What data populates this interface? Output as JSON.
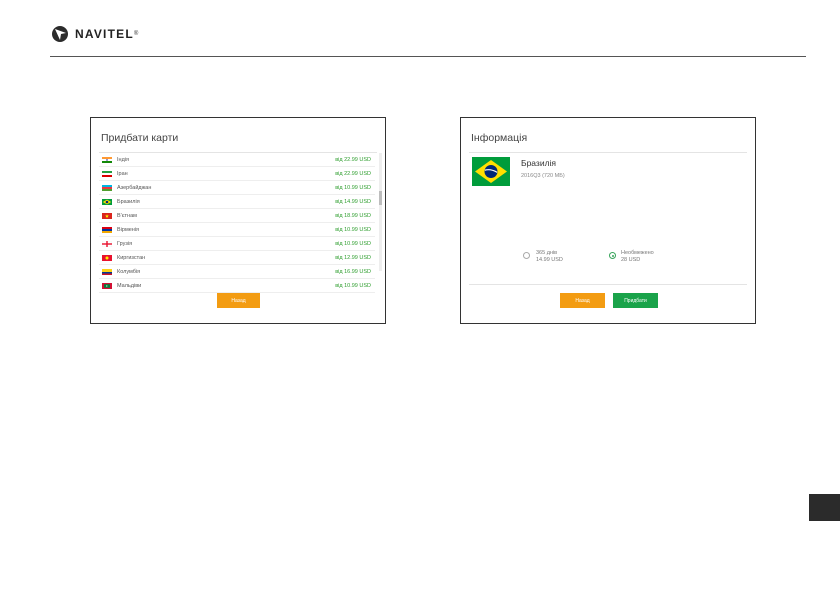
{
  "brand": {
    "name": "NAVITEL",
    "registered": "®"
  },
  "left_screen": {
    "title": "Придбати карти",
    "button_label": "Назад",
    "rows": [
      {
        "country": "Індія",
        "price": "від 22.99 USD",
        "flag": "flag-india"
      },
      {
        "country": "Іран",
        "price": "від 22.99 USD",
        "flag": "flag-iran"
      },
      {
        "country": "Азербайджан",
        "price": "від 10.99 USD",
        "flag": "flag-azerbaijan"
      },
      {
        "country": "Бразилія",
        "price": "від 14.99 USD",
        "flag": "flag-brazil"
      },
      {
        "country": "В'єтнам",
        "price": "від 18.99 USD",
        "flag": "flag-vietnam"
      },
      {
        "country": "Вірменія",
        "price": "від 10.99 USD",
        "flag": "flag-armenia"
      },
      {
        "country": "Грузія",
        "price": "від 10.99 USD",
        "flag": "flag-georgia"
      },
      {
        "country": "Киргизстан",
        "price": "від 12.99 USD",
        "flag": "flag-kyrgyzstan"
      },
      {
        "country": "Колумбія",
        "price": "від 16.99 USD",
        "flag": "flag-colombia"
      },
      {
        "country": "Мальдіви",
        "price": "від 10.99 USD",
        "flag": "flag-maldives"
      }
    ]
  },
  "right_screen": {
    "title": "Інформація",
    "country": "Бразилія",
    "meta": "2016Q3 (720 MБ)",
    "option1_line1": "365 днів",
    "option1_line2": "14.99 USD",
    "option2_line1": "Необмежено",
    "option2_line2": "28 USD",
    "back_label": "Назад",
    "buy_label": "Придбати"
  },
  "colors": {
    "price_green": "#2e9e2e",
    "button_orange": "#f39c12",
    "button_green": "#1aa34a"
  }
}
